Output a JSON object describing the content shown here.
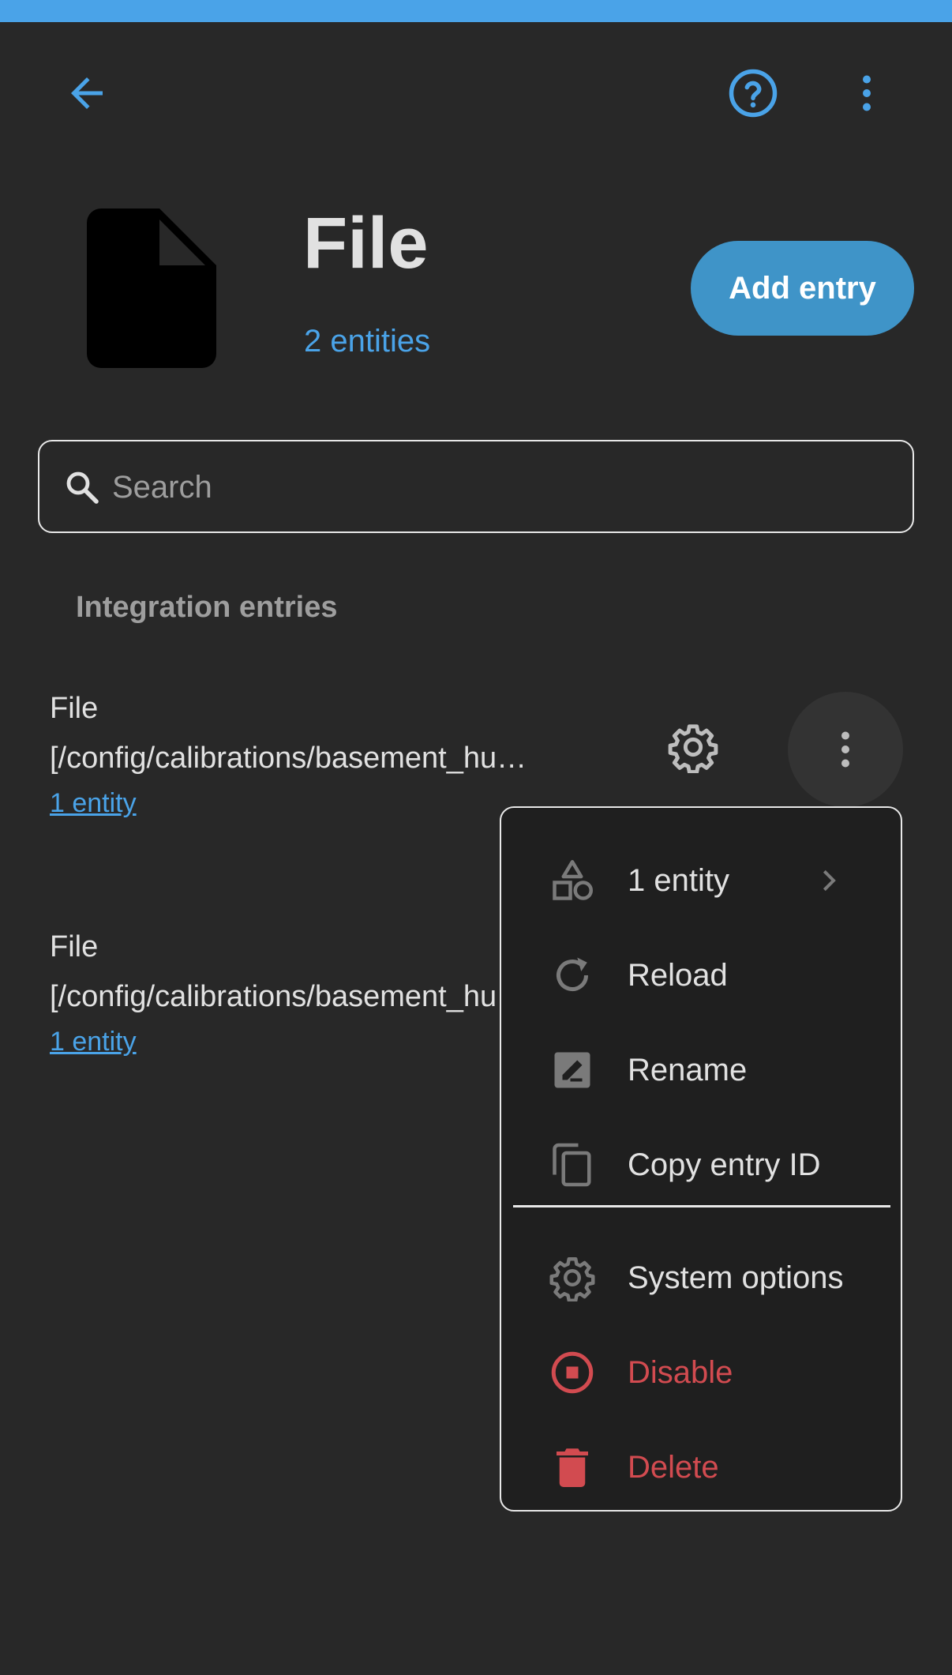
{
  "header": {
    "back_icon": "arrow-left-icon",
    "help_icon": "help-circle-icon",
    "more_icon": "dots-vertical-icon"
  },
  "integration": {
    "title": "File",
    "entities_count": "2 entities",
    "add_entry_label": "Add entry",
    "logo_icon": "file-document-icon"
  },
  "search": {
    "placeholder": "Search",
    "value": ""
  },
  "entries_section": {
    "heading": "Integration entries",
    "entries": [
      {
        "name_line1": "File",
        "name_line2": "[/config/calibrations/basement_hu…",
        "link": "1 entity"
      },
      {
        "name_line1": "File",
        "name_line2": "[/config/calibrations/basement_hu…",
        "link": "1 entity"
      }
    ]
  },
  "context_menu": {
    "items": [
      {
        "label": "1 entity",
        "icon": "shapes-icon"
      },
      {
        "label": "Reload",
        "icon": "reload-icon"
      },
      {
        "label": "Rename",
        "icon": "rename-icon"
      },
      {
        "label": "Copy entry ID",
        "icon": "copy-icon"
      },
      {
        "label": "System options",
        "icon": "gear-icon"
      },
      {
        "label": "Disable",
        "icon": "stop-circle-icon"
      },
      {
        "label": "Delete",
        "icon": "trash-icon"
      }
    ]
  },
  "colors": {
    "accent": "#4aa3e8",
    "danger": "#d24b50",
    "background": "#282828"
  }
}
